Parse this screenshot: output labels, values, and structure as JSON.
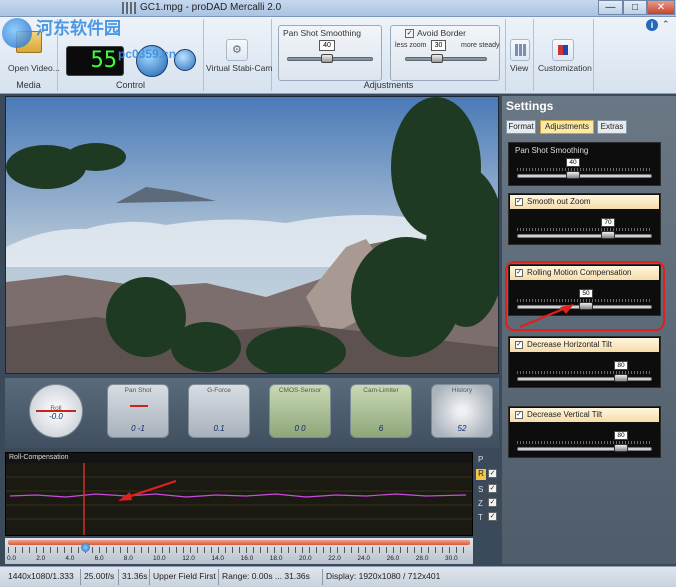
{
  "window": {
    "title": "GC1.mpg - proDAD Mercalli 2.0",
    "controls": {
      "minimize": "—",
      "maximize": "□",
      "close": "✕"
    },
    "help": "i",
    "collapse": "⌃"
  },
  "ribbon": {
    "media": {
      "group_label": "Media",
      "open_label": "Open Video..."
    },
    "control": {
      "group_label": "Control",
      "counter": "55"
    },
    "stabi": {
      "label": "Virtual Stabi-Cam"
    },
    "adjustments": {
      "group_label": "Adjustments",
      "pan_label": "Pan Shot Smoothing",
      "pan_value": "40",
      "avoid_label": "Avoid Border",
      "avoid_checked": "✓",
      "less_label": "less zoom",
      "more_label": "more steady",
      "avoid_value": "30"
    },
    "view": {
      "label": "View"
    },
    "custom": {
      "label": "Customization"
    }
  },
  "watermark": {
    "line1": "河东软件园",
    "line2": "pc0359.cn"
  },
  "instruments": [
    {
      "label": "Roll",
      "value": "-0.0"
    },
    {
      "label": "Pan Shot",
      "value": "0  -1"
    },
    {
      "label": "G-Force",
      "value": "0.1"
    },
    {
      "label": "CMOS-Sensor",
      "value": "0   0"
    },
    {
      "label": "Cam-Limiter",
      "value": "6"
    },
    {
      "label": "History",
      "value": "52"
    }
  ],
  "graph": {
    "title": "Roll-Compensation",
    "channels": [
      "P",
      "R",
      "S",
      "Z",
      "T"
    ]
  },
  "timeline": {
    "ticks": [
      "0.0",
      "2.0",
      "4.0",
      "6.0",
      "8.0",
      "10.0",
      "12.0",
      "14.0",
      "16.0",
      "18.0",
      "20.0",
      "22.0",
      "24.0",
      "26.0",
      "28.0",
      "30.0"
    ]
  },
  "status": {
    "resolution": "1440x1080/1.333",
    "fps": "25.00f/s",
    "duration": "31.36s",
    "field": "Upper Field First",
    "range": "Range: 0.00s ... 31.36s",
    "display": "Display:  1920x1080 / 712x401"
  },
  "settings": {
    "title": "Settings",
    "tabs": [
      "Format",
      "Adjustments",
      "Extras"
    ],
    "cards": [
      {
        "label": "Pan Shot Smoothing",
        "value": "40",
        "check": ""
      },
      {
        "label": "Smooth out Zoom",
        "value": "70",
        "check": "✓"
      },
      {
        "label": "Rolling Motion Compensation",
        "value": "50",
        "check": "✓"
      },
      {
        "label": "Decrease Horizontal Tilt",
        "value": "80",
        "check": "✓"
      },
      {
        "label": "Decrease Vertical Tilt",
        "value": "80",
        "check": "✓"
      }
    ]
  }
}
